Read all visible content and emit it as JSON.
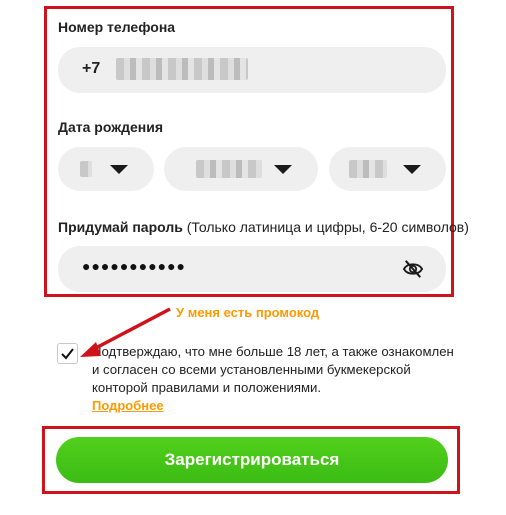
{
  "phone": {
    "label": "Номер телефона",
    "prefix": "+7"
  },
  "birthdate": {
    "label": "Дата рождения"
  },
  "password": {
    "label": "Придумай пароль",
    "hint": "(Только латиница и цифры, 6-20 символов)",
    "masked_value": "●●●●●●●●●●●",
    "toggle_icon": "eye-off-icon"
  },
  "promo": {
    "label": "У меня есть промокод"
  },
  "consent": {
    "checked": true,
    "text": "Подтверждаю, что мне больше 18 лет, а также ознакомлен и согласен со всеми установленными букмекерской конторой правилами и положениями.",
    "more_link": "Подробнее"
  },
  "submit": {
    "label": "Зарегистрироваться"
  },
  "colors": {
    "highlight_frame": "#d0121b",
    "accent_orange": "#ff9a00",
    "button_green": "#45c51a",
    "field_bg": "#efefef"
  }
}
